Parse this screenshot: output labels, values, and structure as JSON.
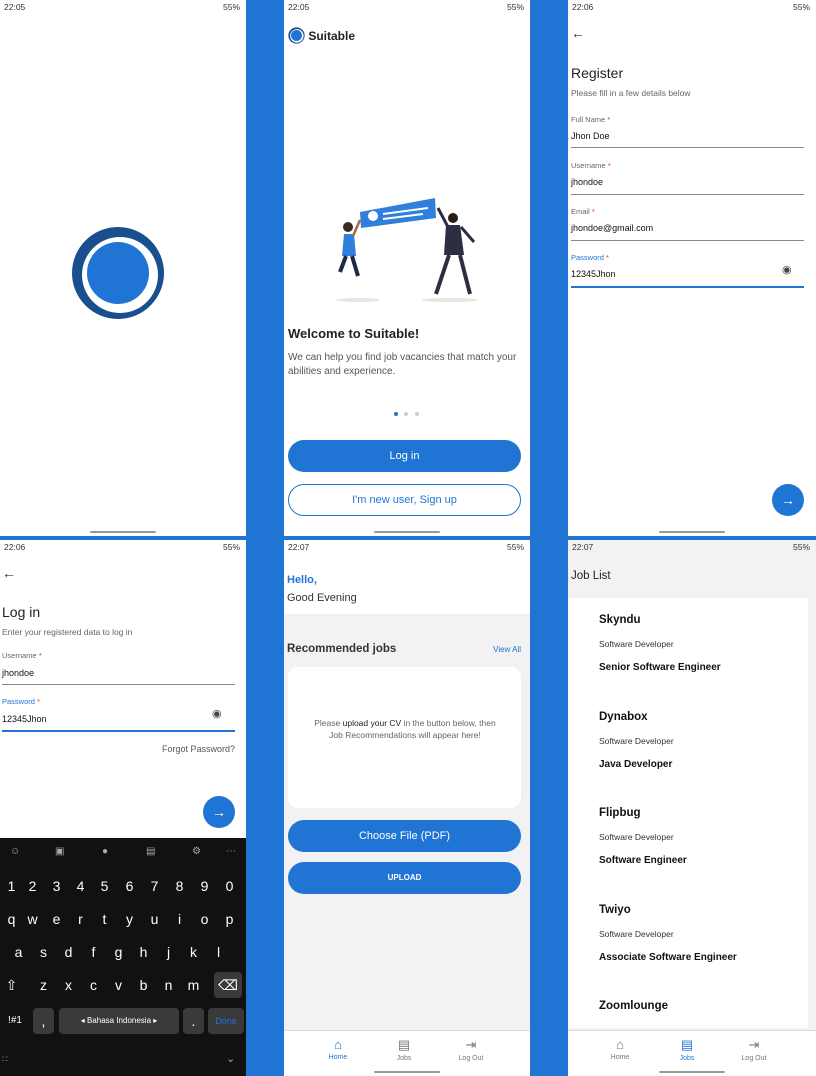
{
  "status_bars": [
    {
      "time": "22:05",
      "sys": "55%"
    },
    {
      "time": "22:05",
      "sys": "55%"
    },
    {
      "time": "22:06",
      "sys": "55%"
    },
    {
      "time": "22:06",
      "sys": "55%"
    },
    {
      "time": "22:07",
      "sys": "55%"
    },
    {
      "time": "22:07",
      "sys": "55%"
    }
  ],
  "onboarding": {
    "brand": "Suitable",
    "welcome_title": "Welcome to Suitable!",
    "welcome_text": "We can help you find job vacancies that match your abilities and experience.",
    "login_label": "Log in",
    "signup_label": "I'm new user, Sign up"
  },
  "register": {
    "title": "Register",
    "subtitle": "Please fill in a few details below",
    "fields": [
      {
        "label": "Full Name",
        "value": "Jhon Doe"
      },
      {
        "label": "Username",
        "value": "jhondoe"
      },
      {
        "label": "Email",
        "value": "jhondoe@gmail.com"
      },
      {
        "label": "Password",
        "value": "12345Jhon"
      }
    ],
    "required_mark": "*"
  },
  "login": {
    "title": "Log in",
    "subtitle": "Enter your registered data to log in",
    "fields": [
      {
        "label": "Username",
        "value": "jhondoe"
      },
      {
        "label": "Password",
        "value": "12345Jhon"
      }
    ],
    "forgot": "Forgot Password?",
    "keyboard": {
      "numbers": [
        "1",
        "2",
        "3",
        "4",
        "5",
        "6",
        "7",
        "8",
        "9",
        "0"
      ],
      "row1": [
        "q",
        "w",
        "e",
        "r",
        "t",
        "y",
        "u",
        "i",
        "o",
        "p"
      ],
      "row2": [
        "a",
        "s",
        "d",
        "f",
        "g",
        "h",
        "j",
        "k",
        "l"
      ],
      "row3": [
        "z",
        "x",
        "c",
        "v",
        "b",
        "n",
        "m"
      ],
      "sym": "!#1",
      "comma": ",",
      "space": "◂ Bahasa Indonesia ▸",
      "period": ".",
      "done": "Done"
    }
  },
  "home": {
    "hello": "Hello,",
    "greeting": "Good Evening",
    "section_title": "Recommended jobs",
    "view_all": "View All",
    "empty_pre": "Please ",
    "empty_bold": "upload your CV",
    "empty_post": " in the button below, then Job Recommendations will appear here!",
    "choose_file": "Choose File (PDF)",
    "upload": "UPLOAD"
  },
  "joblist": {
    "title": "Job List",
    "jobs": [
      {
        "company": "Skyndu",
        "category": "Software Developer",
        "role": "Senior Software Engineer"
      },
      {
        "company": "Dynabox",
        "category": "Software Developer",
        "role": "Java Developer"
      },
      {
        "company": "Flipbug",
        "category": "Software Developer",
        "role": "Software Engineer"
      },
      {
        "company": "Twiyo",
        "category": "Software Developer",
        "role": "Associate Software Engineer"
      },
      {
        "company": "Zoomlounge",
        "category": "",
        "role": ""
      }
    ]
  },
  "nav": [
    {
      "label": "Home",
      "icon": "home-icon"
    },
    {
      "label": "Jobs",
      "icon": "jobs-icon"
    },
    {
      "label": "Log Out",
      "icon": "logout-icon"
    }
  ],
  "colors": {
    "accent": "#1f74d4",
    "background": "#1f74d4"
  }
}
